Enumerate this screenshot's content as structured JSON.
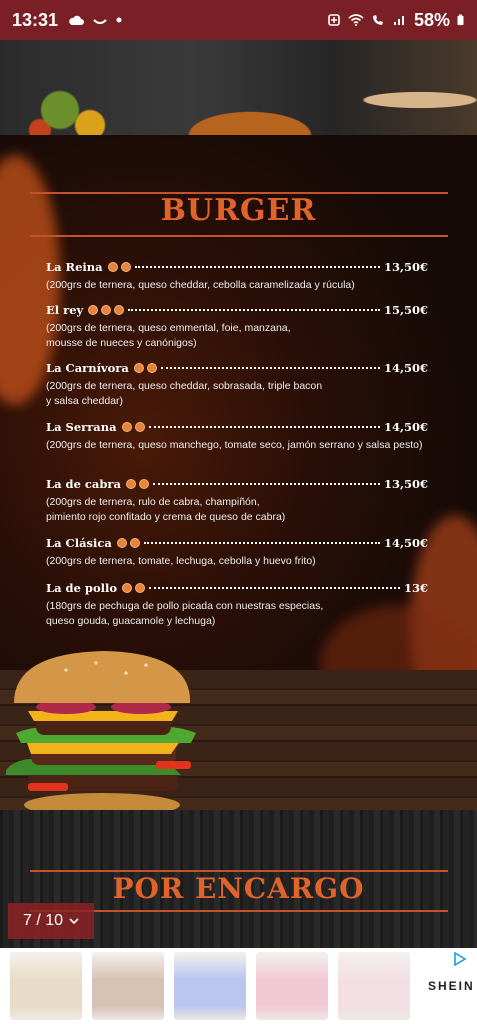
{
  "status_bar": {
    "time": "13:31",
    "battery": "58%",
    "icons": [
      "cloud-icon",
      "link-icon",
      "dot-icon",
      "battery-saver-icon",
      "wifi-icon",
      "wifi-calling-icon",
      "signal-icon",
      "battery-icon"
    ]
  },
  "menu": {
    "section_title": "BURGER",
    "items": [
      {
        "name": "La Reina",
        "price": "13,50€",
        "desc": "(200grs de ternera, queso cheddar, cebolla caramelizada y rúcula)",
        "allergens": 2
      },
      {
        "name": "El rey",
        "price": "15,50€",
        "desc": "(200grs de ternera, queso emmental, foie, manzana,\nmousse de nueces y canónigos)",
        "allergens": 3
      },
      {
        "name": "La Carnívora",
        "price": "14,50€",
        "desc": "(200grs de ternera, queso cheddar, sobrasada, triple bacon\ny salsa cheddar)",
        "allergens": 2
      },
      {
        "name": "La Serrana",
        "price": "14,50€",
        "desc": "(200grs de ternera, queso manchego, tomate seco, jamón serrano y salsa pesto)",
        "allergens": 2
      },
      {
        "name": "La de cabra",
        "price": "13,50€",
        "desc": "(200grs de ternera, rulo de cabra, champiñón,\npimiento rojo confitado y crema de queso de cabra)",
        "allergens": 2
      },
      {
        "name": "La Clásica",
        "price": "14,50€",
        "desc": "(200grs de ternera, tomate, lechuga, cebolla y huevo frito)",
        "allergens": 2
      },
      {
        "name": "La de pollo",
        "price": "13€",
        "desc": "(180grs de pechuga de pollo picada con nuestras especias,\nqueso gouda, guacamole y lechuga)",
        "allergens": 2
      }
    ]
  },
  "next_section": {
    "title": "POR ENCARGO"
  },
  "pager": {
    "label": "7 / 10"
  },
  "ad": {
    "brand": "SHEIN",
    "colors": [
      "#e8dcc8",
      "#d7c3b4",
      "#b9c7ef",
      "#f1c9d2",
      "#f3dfe3"
    ]
  },
  "colors": {
    "accent": "#e0642a",
    "status_bar": "#7a1f26"
  }
}
